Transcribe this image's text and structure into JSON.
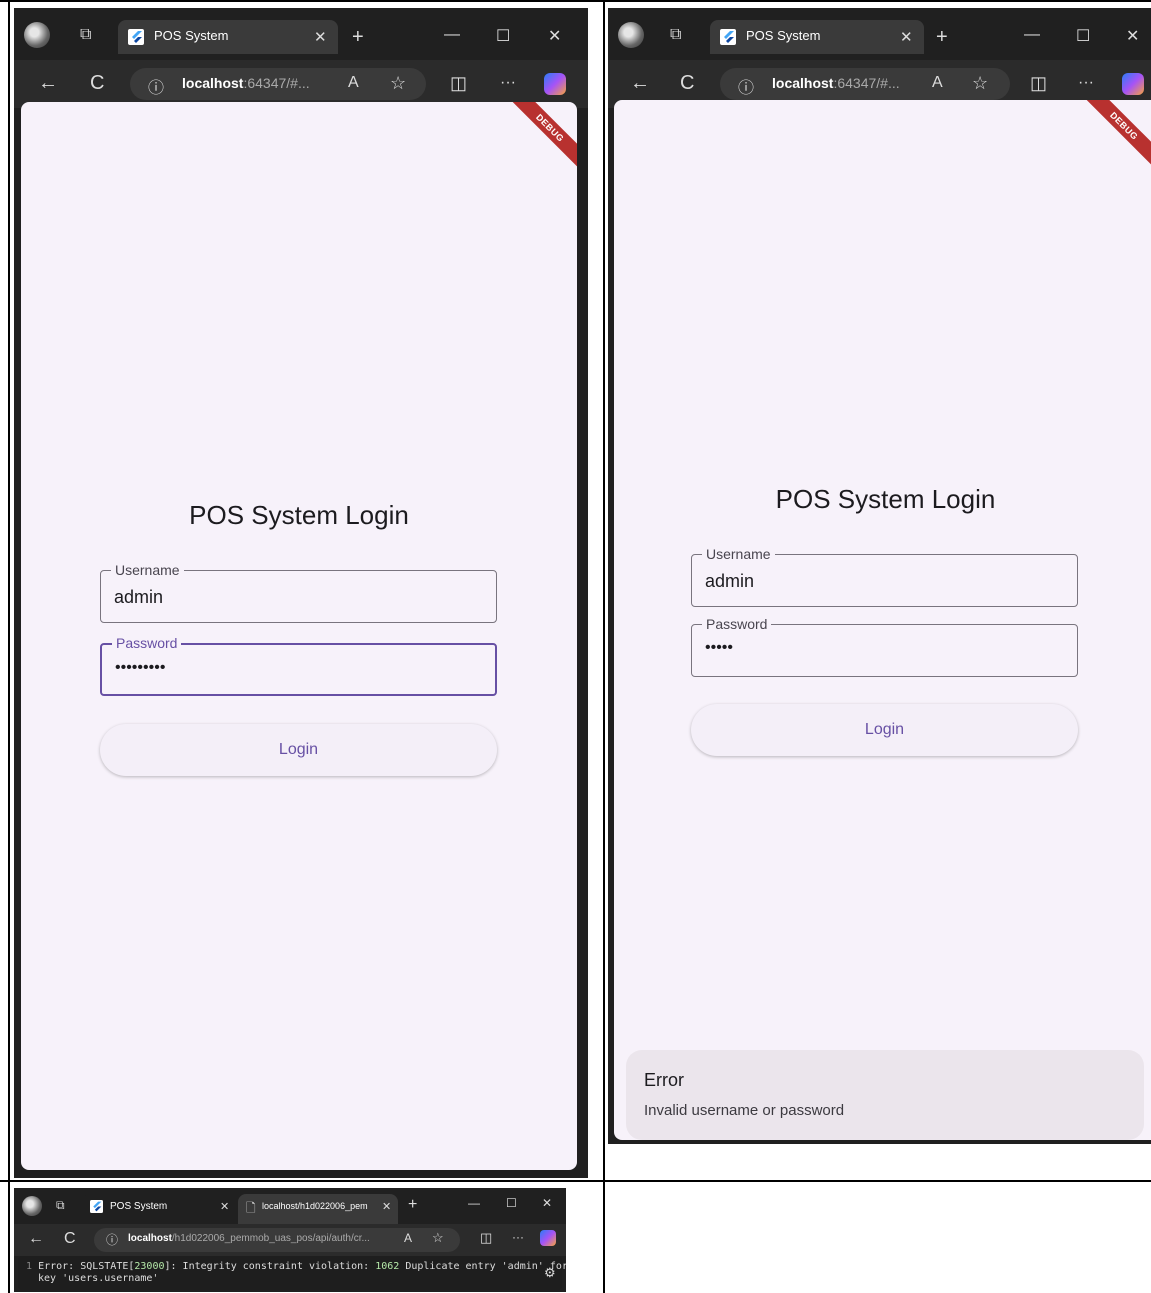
{
  "panel_left": {
    "tab_title": "POS System",
    "url_host": "localhost",
    "url_rest": ":64347/#...",
    "debug_banner": "DEBUG",
    "login_title": "POS System Login",
    "username_label": "Username",
    "username_value": "admin",
    "password_label": "Password",
    "password_value": "•••••••••",
    "login_button": "Login"
  },
  "panel_right": {
    "tab_title": "POS System",
    "url_host": "localhost",
    "url_rest": ":64347/#...",
    "debug_banner": "DEBUG",
    "login_title": "POS System Login",
    "username_label": "Username",
    "username_value": "admin",
    "password_label": "Password",
    "password_value": "•••••",
    "login_button": "Login",
    "snackbar_title": "Error",
    "snackbar_message": "Invalid username or password"
  },
  "panel_bottom": {
    "tab1_title": "POS System",
    "tab2_title": "localhost/h1d022006_pem",
    "url_host": "localhost",
    "url_rest": "/h1d022006_pemmob_uas_pos/api/auth/cr...",
    "line_number": "1",
    "error_prefix": "Error: SQLSTATE[",
    "error_code": "23000",
    "error_mid": "]: Integrity constraint violation: ",
    "error_num": "1062",
    "error_rest": " Duplicate entry 'admin' for",
    "error_line2": "key 'users.username'"
  },
  "icons": {
    "back": "←",
    "reload": "C",
    "info": "ⓘ",
    "read_aloud": "A",
    "favorite": "☆",
    "split": "◫",
    "more": "···",
    "new_tab": "+",
    "minimize": "—",
    "maximize": "☐",
    "close": "✕",
    "tab_close": "✕"
  }
}
